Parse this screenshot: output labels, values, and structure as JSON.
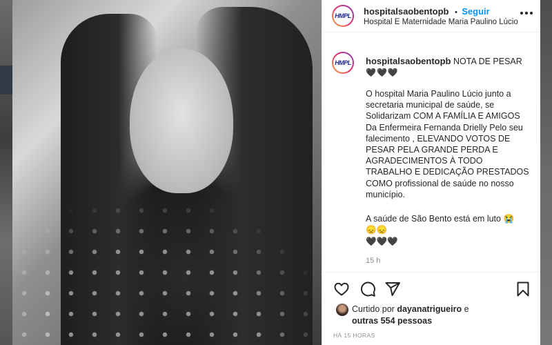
{
  "post": {
    "username": "hospitalsaobentopb",
    "follow_label": "Seguir",
    "follow_separator": "•",
    "location": "Hospital E Maternidade Maria Paulino Lúcio",
    "avatar_text": "HMPL",
    "caption_title": "NOTA DE PESAR",
    "caption_hearts": "🖤🖤🖤",
    "caption_body": "O hospital Maria Paulino Lúcio junto a secretaria municipal de saúde, se Solidarizam COM A FAMÍLIA E AMIGOS Da Enfermeira Fernanda Drielly Pelo seu falecimento , ELEVANDO VOTOS DE PESAR PELA GRANDE PERDA E AGRADECIMENTOS À TODO TRABALHO E DEDICAÇÃO PRESTADOS COMO profissional de saúde no nosso município.",
    "caption_closing": "A saúde de São Bento está em luto 😭",
    "caption_emojis_1": "😞😞",
    "caption_emojis_2": "🖤🖤🖤",
    "caption_age": "15 h",
    "liked_by_prefix": "Curtido por",
    "liked_by_user": "dayanatrigueiro",
    "liked_by_and": "e",
    "liked_by_others": "outras 554 pessoas",
    "time_ago": "HÁ 15 HORAS"
  },
  "icons": {
    "like": "heart-icon",
    "comment": "comment-icon",
    "share": "send-icon",
    "save": "bookmark-icon",
    "more": "more-icon"
  },
  "colors": {
    "link": "#0095f6",
    "text": "#262626",
    "muted": "#8e8e8e"
  }
}
